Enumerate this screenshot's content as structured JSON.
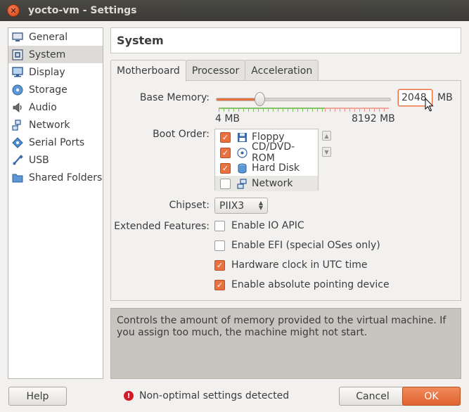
{
  "window": {
    "title": "yocto-vm - Settings"
  },
  "sidebar": {
    "items": [
      {
        "label": "General",
        "icon": "general-icon"
      },
      {
        "label": "System",
        "icon": "system-icon",
        "selected": true
      },
      {
        "label": "Display",
        "icon": "display-icon"
      },
      {
        "label": "Storage",
        "icon": "storage-icon"
      },
      {
        "label": "Audio",
        "icon": "audio-icon"
      },
      {
        "label": "Network",
        "icon": "network-icon"
      },
      {
        "label": "Serial Ports",
        "icon": "serial-ports-icon"
      },
      {
        "label": "USB",
        "icon": "usb-icon"
      },
      {
        "label": "Shared Folders",
        "icon": "shared-folders-icon"
      }
    ]
  },
  "page": {
    "title": "System"
  },
  "tabs": [
    {
      "label": "Motherboard",
      "active": true
    },
    {
      "label": "Processor"
    },
    {
      "label": "Acceleration"
    }
  ],
  "motherboard": {
    "base_memory": {
      "label": "Base Memory:",
      "value": "2048",
      "unit": "MB",
      "min_label": "4 MB",
      "max_label": "8192 MB",
      "fraction": 0.25
    },
    "boot_order": {
      "label": "Boot Order:",
      "items": [
        {
          "label": "Floppy",
          "checked": true,
          "icon": "floppy-icon"
        },
        {
          "label": "CD/DVD-ROM",
          "checked": true,
          "icon": "cd-dvd-icon"
        },
        {
          "label": "Hard Disk",
          "checked": true,
          "icon": "hard-disk-icon"
        },
        {
          "label": "Network",
          "checked": false,
          "icon": "network-boot-icon"
        }
      ]
    },
    "chipset": {
      "label": "Chipset:",
      "value": "PIIX3"
    },
    "extended_features": {
      "label": "Extended Features:",
      "items": [
        {
          "label": "Enable IO APIC",
          "checked": false
        },
        {
          "label": "Enable EFI (special OSes only)",
          "checked": false
        },
        {
          "label": "Hardware clock in UTC time",
          "checked": true
        },
        {
          "label": "Enable absolute pointing device",
          "checked": true
        }
      ]
    }
  },
  "description": "Controls the amount of memory provided to the virtual machine. If you assign too much, the machine might not start.",
  "footer": {
    "help_label": "Help",
    "warning": "Non-optimal settings detected",
    "cancel_label": "Cancel",
    "ok_label": "OK"
  },
  "colors": {
    "accent": "#e9703f",
    "titlebar": "#3c3b37",
    "warning": "#d01b2b"
  }
}
